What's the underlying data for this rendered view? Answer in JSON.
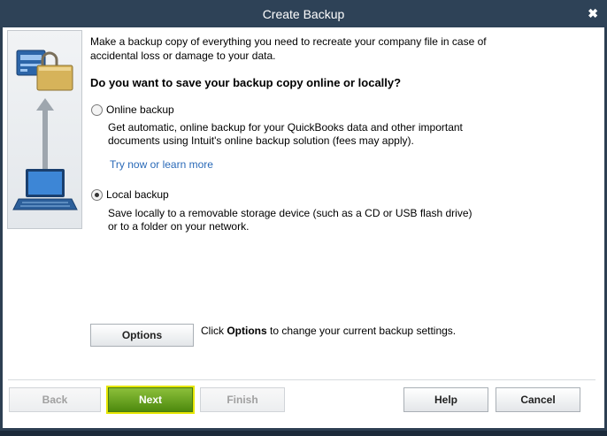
{
  "window": {
    "title": "Create Backup",
    "close_glyph": "✖"
  },
  "intro": {
    "line1": "Make a backup copy of everything you need to recreate your company file in case of",
    "line2": "accidental loss or damage to your data."
  },
  "question": "Do you want to save your backup copy online or locally?",
  "online": {
    "label": "Online backup",
    "selected": false,
    "desc1": "Get automatic, online backup for your QuickBooks data and other important",
    "desc2": "documents using Intuit's online backup solution (fees may apply).",
    "link": "Try now or learn more"
  },
  "local": {
    "label": "Local backup",
    "selected": true,
    "desc1": "Save locally to a removable storage device (such as a CD or USB flash drive)",
    "desc2": "or to a folder on your network."
  },
  "options": {
    "button": "Options",
    "hint_prefix": "Click ",
    "hint_bold": "Options",
    "hint_suffix": " to change your current backup settings."
  },
  "footer": {
    "back": "Back",
    "next": "Next",
    "finish": "Finish",
    "help": "Help",
    "cancel": "Cancel"
  },
  "colors": {
    "title_bar": "#2e4257",
    "next_button": "#6aa01f",
    "link": "#2a6ab8",
    "focus_outline": "#e6e600"
  },
  "icons": {
    "top": "computer-lock-icon",
    "arrow": "up-arrow-icon",
    "bottom": "laptop-icon"
  }
}
